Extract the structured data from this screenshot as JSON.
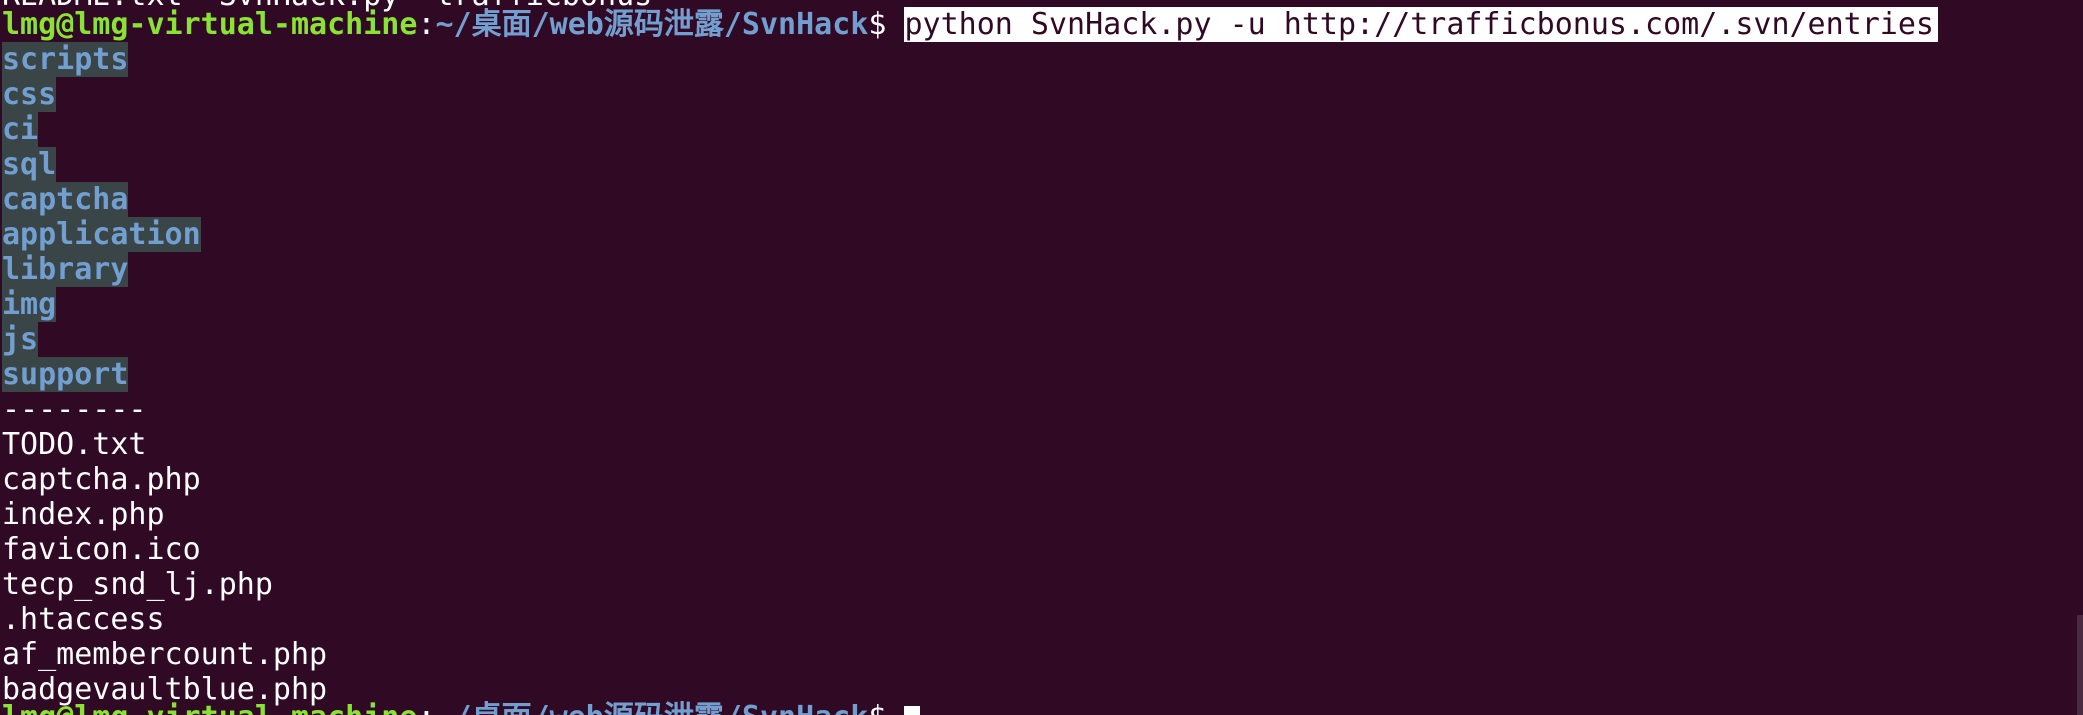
{
  "terminal": {
    "cut_top_text": "README.txt  SvnHack.py  trafficbonus",
    "prompt": {
      "user_host": "lmg@lmg-virtual-machine",
      "colon": ":",
      "path": "~/桌面/web源码泄露/SvnHack",
      "dollar": "$ "
    },
    "command": "python SvnHack.py -u http://trafficbonus.com/.svn/entries",
    "directories": [
      "scripts",
      "css",
      "ci",
      "sql",
      "captcha",
      "application",
      "library",
      "img",
      "js",
      "support"
    ],
    "separator": "--------",
    "files": [
      "TODO.txt",
      "captcha.php",
      "index.php",
      "favicon.ico",
      "tecp_snd_lj.php",
      ".htaccess",
      "af_membercount.php",
      "badgevaultblue.php"
    ],
    "bottom_prompt": {
      "user_host": "lmg@lmg-virtual-machine",
      "colon": ":",
      "path": "~/桌面/web源码泄露/SvnHack",
      "dollar": "$ "
    }
  },
  "colors": {
    "background": "#300a24",
    "user": "#8ae234",
    "path": "#729fcf",
    "dir_bg": "#3a4548"
  }
}
